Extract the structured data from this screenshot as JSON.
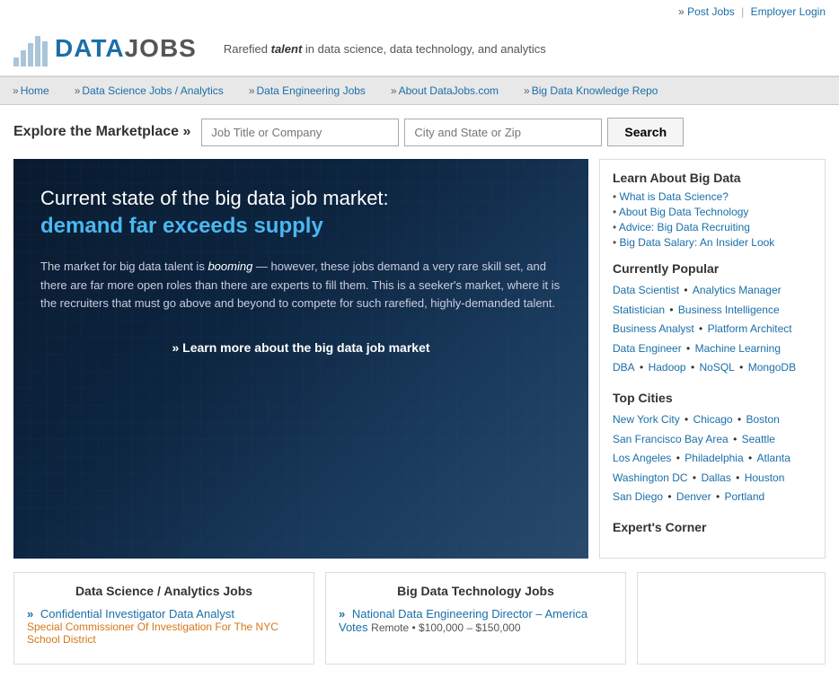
{
  "topbar": {
    "post_jobs": "Post Jobs",
    "separator": "|",
    "employer_login": "Employer Login",
    "arrow": "»"
  },
  "logo": {
    "data": "DATA",
    "jobs": "JOBS",
    "tagline": "Rarefied",
    "tagline_em": "talent",
    "tagline_rest": " in data science, data technology, and analytics"
  },
  "nav": {
    "items": [
      {
        "label": "Home"
      },
      {
        "label": "Data Science Jobs / Analytics"
      },
      {
        "label": "Data Engineering Jobs"
      },
      {
        "label": "About DataJobs.com"
      },
      {
        "label": "Big Data Knowledge Repo"
      }
    ]
  },
  "search": {
    "label": "Explore the Marketplace »",
    "placeholder1": "Job Title or Company",
    "placeholder2": "City and State or Zip",
    "button": "Search"
  },
  "hero": {
    "title": "Current state of the big data job market:",
    "highlight": "demand far exceeds supply",
    "body1": "The market for big data talent is ",
    "body_em": "booming",
    "body2": " — however, these jobs demand a very rare skill set, and there are far more open roles than there are experts to fill them. This is a seeker's market, where it is the recruiters that must go above and beyond to compete for such rarefied, highly-demanded talent.",
    "link": "» Learn more about the big data job market"
  },
  "sidebar": {
    "learn_heading": "Learn About Big Data",
    "learn_links": [
      "What is Data Science?",
      "About Big Data Technology",
      "Advice: Big Data Recruiting",
      "Big Data Salary: An Insider Look"
    ],
    "popular_heading": "Currently Popular",
    "popular_links": [
      "Data Scientist",
      "Analytics Manager",
      "Statistician",
      "Business Intelligence",
      "Business Analyst",
      "Platform Architect",
      "Data Engineer",
      "Machine Learning",
      "DBA",
      "Hadoop",
      "NoSQL",
      "MongoDB"
    ],
    "cities_heading": "Top Cities",
    "cities": [
      "New York City",
      "Chicago",
      "Boston",
      "San Francisco Bay Area",
      "Seattle",
      "Los Angeles",
      "Philadelphia",
      "Atlanta",
      "Washington DC",
      "Dallas",
      "Houston",
      "San Diego",
      "Denver",
      "Portland"
    ],
    "expert_heading": "Expert's Corner"
  },
  "card1": {
    "title": "Data Science / Analytics Jobs",
    "job1_title": "Confidential Investigator Data Analyst",
    "job1_company": "Special Commissioner Of Investigation For The NYC School District",
    "arrow": "»"
  },
  "card2": {
    "title": "Big Data Technology Jobs",
    "job1_title": "National Data Engineering Director – America Votes",
    "job1_location": "Remote",
    "job1_salary": "$100,000 – $150,000",
    "arrow": "»"
  }
}
